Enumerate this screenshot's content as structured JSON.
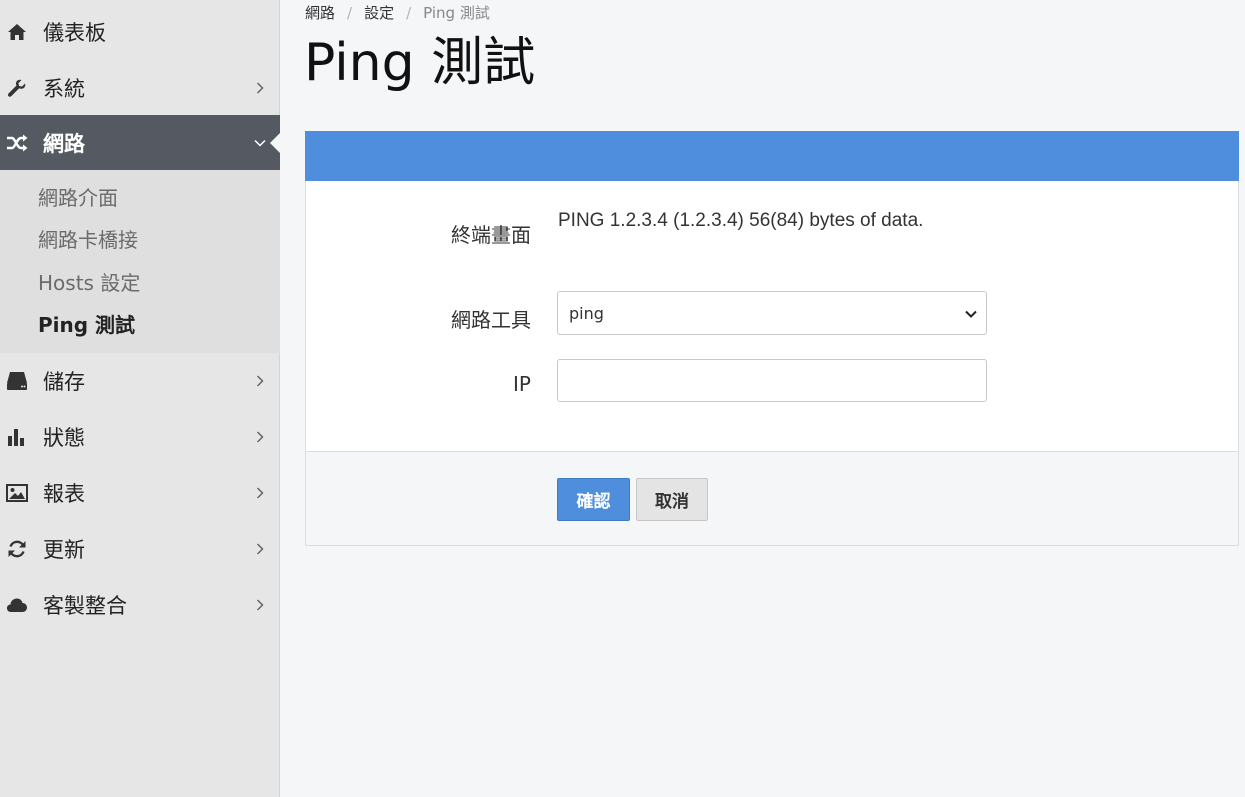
{
  "sidebar": {
    "items": [
      {
        "label": "儀表板",
        "icon": "home-icon",
        "has_children": false
      },
      {
        "label": "系統",
        "icon": "wrench-icon",
        "has_children": true
      },
      {
        "label": "網路",
        "icon": "shuffle-icon",
        "has_children": true,
        "active": true
      },
      {
        "label": "儲存",
        "icon": "hdd-icon",
        "has_children": true
      },
      {
        "label": "狀態",
        "icon": "bar-chart-icon",
        "has_children": true
      },
      {
        "label": "報表",
        "icon": "image-icon",
        "has_children": true
      },
      {
        "label": "更新",
        "icon": "refresh-icon",
        "has_children": true
      },
      {
        "label": "客製整合",
        "icon": "cloud-icon",
        "has_children": true
      }
    ],
    "subitems": [
      {
        "label": "網路介面"
      },
      {
        "label": "網路卡橋接"
      },
      {
        "label": "Hosts 設定"
      },
      {
        "label": "Ping 測試",
        "current": true
      }
    ]
  },
  "breadcrumb": {
    "items": [
      "網路",
      "設定",
      "Ping 測試"
    ],
    "separator": "/"
  },
  "page": {
    "title": "Ping 測試"
  },
  "form": {
    "terminal_label": "終端畫面",
    "terminal_output": "PING 1.2.3.4 (1.2.3.4) 56(84) bytes of data.",
    "tool_label": "網路工具",
    "tool_selected": "ping",
    "ip_label": "IP",
    "ip_value": "",
    "confirm_label": "確認",
    "cancel_label": "取消"
  },
  "colors": {
    "accent": "#4e8edc",
    "sidebar_active": "#555a62",
    "sidebar_bg": "#e6e6e6"
  }
}
